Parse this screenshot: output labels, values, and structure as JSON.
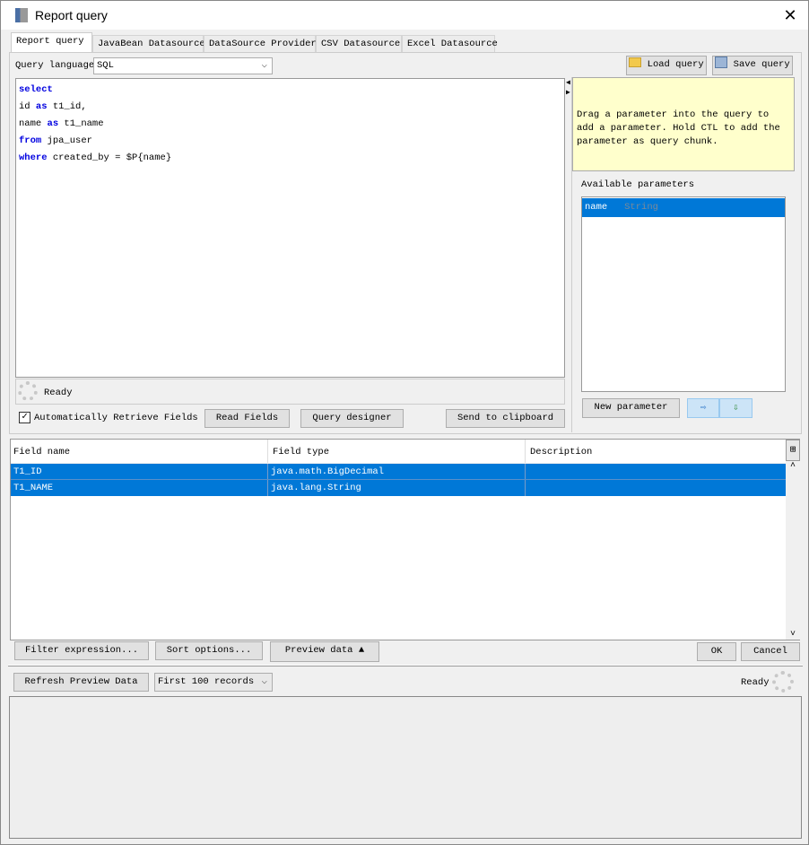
{
  "window": {
    "title": "Report query",
    "close_icon": "close-icon"
  },
  "tabs": [
    {
      "label": "Report query",
      "active": true
    },
    {
      "label": "JavaBean Datasource"
    },
    {
      "label": "DataSource Provider"
    },
    {
      "label": "CSV Datasource"
    },
    {
      "label": "Excel Datasource"
    }
  ],
  "query": {
    "language_label": "Query language",
    "language_value": "SQL",
    "load_label": "Load query",
    "save_label": "Save query",
    "lines": [
      {
        "kw": "select",
        "rest": ""
      },
      {
        "pre": "id ",
        "kw": "as",
        "rest": " t1_id,"
      },
      {
        "pre": "name ",
        "kw": "as",
        "rest": " t1_name"
      },
      {
        "kw": "from",
        "rest": " jpa_user"
      },
      {
        "kw": "where",
        "rest": " created_by = $P{name}"
      }
    ],
    "status": "Ready",
    "auto_retrieve_label": "Automatically Retrieve Fields",
    "auto_retrieve_checked": true,
    "read_fields_label": "Read Fields",
    "query_designer_label": "Query designer",
    "send_clipboard_label": "Send to clipboard"
  },
  "params": {
    "hint": "Drag a parameter into the query to add a parameter. Hold CTL to add the parameter as query chunk.",
    "available_label": "Available parameters",
    "items": [
      {
        "name": "name",
        "type": "String",
        "selected": true
      }
    ],
    "new_param_label": "New parameter"
  },
  "fields": {
    "headers": [
      "Field name",
      "Field type",
      "Description"
    ],
    "rows": [
      {
        "name": "T1_ID",
        "type": "java.math.BigDecimal",
        "description": ""
      },
      {
        "name": "T1_NAME",
        "type": "java.lang.String",
        "description": ""
      }
    ]
  },
  "actions": {
    "filter_label": "Filter expression...",
    "sort_label": "Sort options...",
    "preview_label": "Preview data",
    "ok_label": "OK",
    "cancel_label": "Cancel"
  },
  "preview": {
    "refresh_label": "Refresh Preview Data",
    "records_value": "First 100 records",
    "status": "Ready"
  },
  "colors": {
    "selection": "#0078d7",
    "keyword": "#0000e0",
    "hint_bg": "#ffffcc"
  }
}
